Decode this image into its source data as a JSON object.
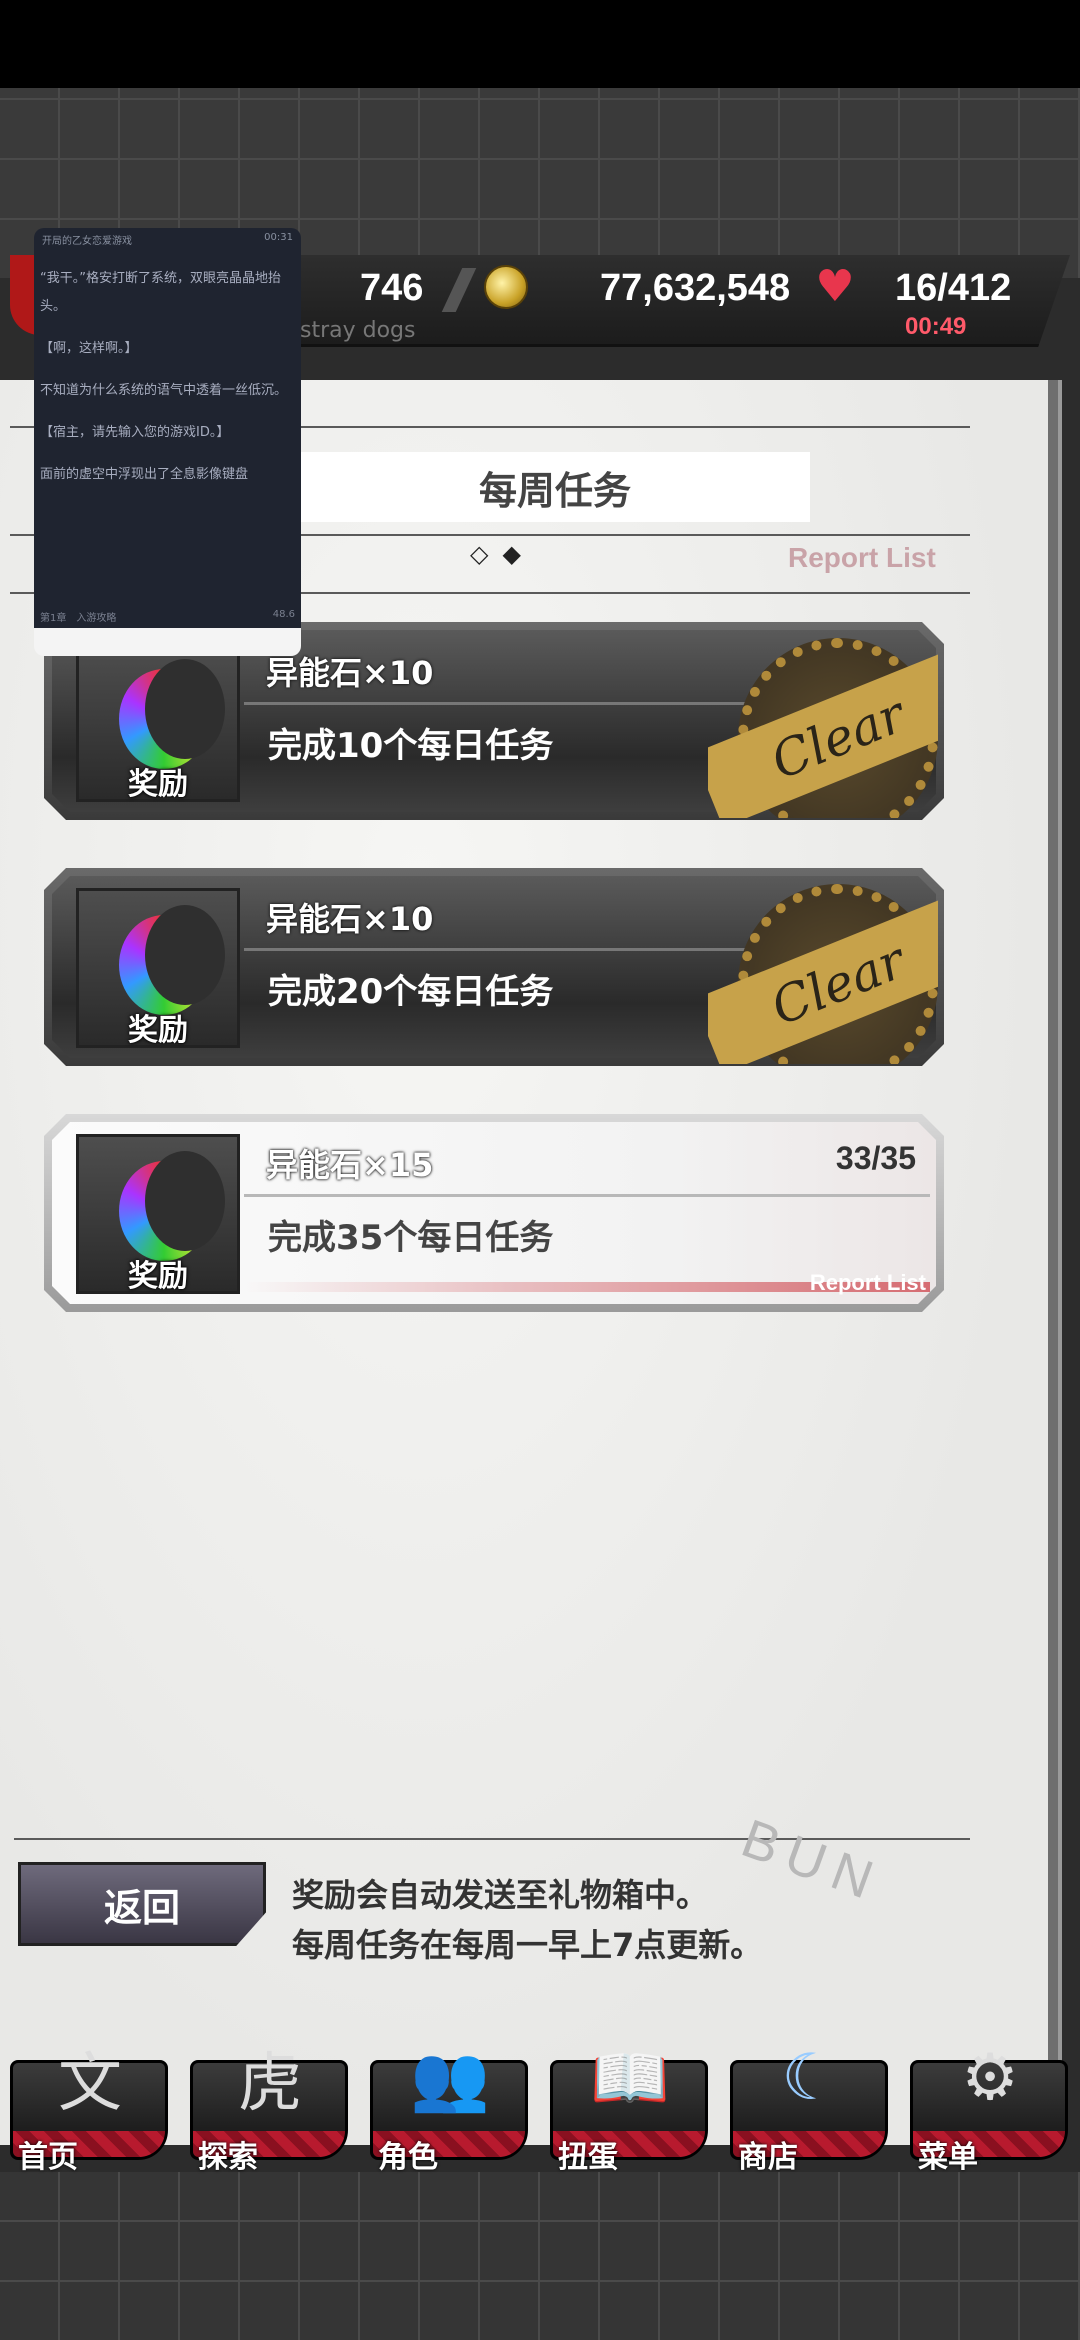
{
  "resources": {
    "energy": "746",
    "coins": "77,632,548",
    "hp": "16/412",
    "timer": "00:49",
    "subtitle": "stray dogs"
  },
  "reader_overlay": {
    "header_left": "开局的乙女恋爱游戏",
    "header_right": "00:31",
    "paragraphs": [
      "“我干。”格安打断了系统，双眼亮晶晶地抬头。",
      "【啊，这样啊。】",
      "不知道为什么系统的语气中透着一丝低沉。",
      "【宿主，请先输入您的游戏ID。】",
      "面前的虚空中浮现出了全息影像键盘"
    ],
    "footer_left": "第1章　入游攻略",
    "footer_right": "48.6"
  },
  "header": {
    "title": "每周任务",
    "pager": "◇◆",
    "report_list": "Report List"
  },
  "missions": [
    {
      "reward": "异能石×10",
      "description": "完成10个每日任务",
      "reward_label": "奖励",
      "status": "Clear",
      "progress": "",
      "report": ""
    },
    {
      "reward": "异能石×10",
      "description": "完成20个每日任务",
      "reward_label": "奖励",
      "status": "Clear",
      "progress": "",
      "report": ""
    },
    {
      "reward": "异能石×15",
      "description": "完成35个每日任务",
      "reward_label": "奖励",
      "status": "",
      "progress": "33/35",
      "report": "Report List"
    }
  ],
  "footer": {
    "back_label": "返回",
    "note_line1": "奖励会自动发送至礼物箱中。",
    "note_line2": "每周任务在每周一早上7点更新。",
    "watermark": "BUN"
  },
  "nav": [
    {
      "label": "首页",
      "icon": "home-icon",
      "glyph": "文"
    },
    {
      "label": "探索",
      "icon": "tiger-icon",
      "glyph": "虎"
    },
    {
      "label": "角色",
      "icon": "characters-icon",
      "glyph": "👥"
    },
    {
      "label": "扭蛋",
      "icon": "book-icon",
      "glyph": "📖"
    },
    {
      "label": "商店",
      "icon": "moon-stone-icon",
      "glyph": "☾"
    },
    {
      "label": "菜单",
      "icon": "gear-icon",
      "glyph": "⚙"
    }
  ],
  "colors": {
    "accent_red": "#b81a2e",
    "stamp_gold": "#c7a24a",
    "timer_red": "#ff5a6a"
  }
}
